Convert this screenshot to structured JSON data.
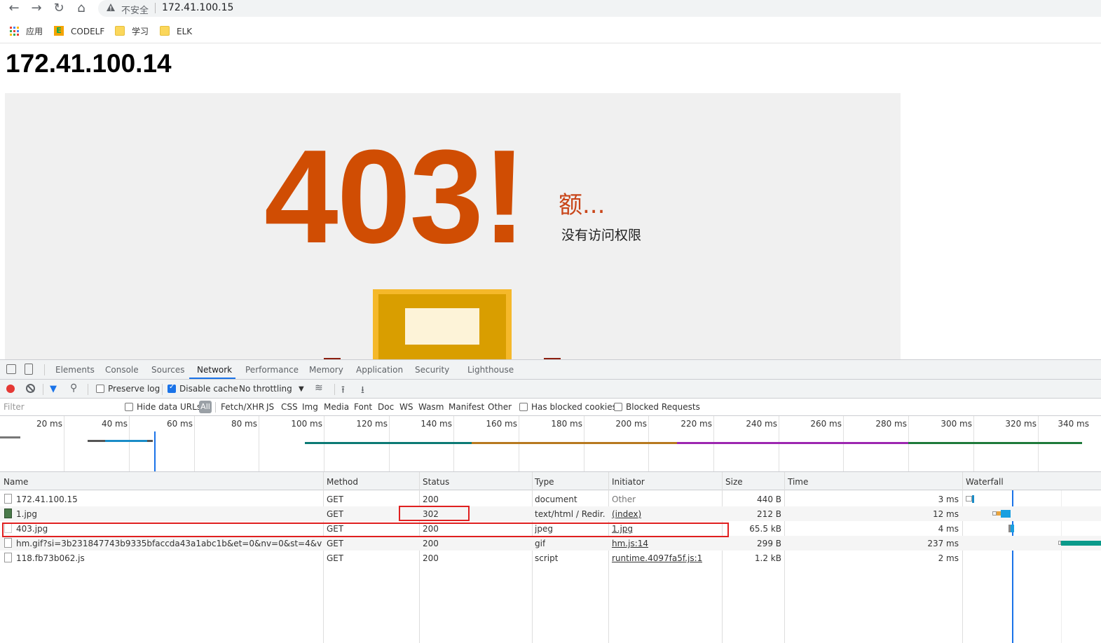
{
  "browser": {
    "url": "172.41.100.15",
    "security_label": "不安全",
    "bookmarks": [
      {
        "label": "应用",
        "icon": "apps-grid-icon"
      },
      {
        "label": "CODELF",
        "icon": "codelf-icon"
      },
      {
        "label": "学习",
        "icon": "folder-icon"
      },
      {
        "label": "ELK",
        "icon": "folder-icon"
      }
    ]
  },
  "page": {
    "heading": "172.41.100.14",
    "error_code": "403!",
    "error_sub1": "额...",
    "error_sub2": "没有访问权限"
  },
  "devtools": {
    "tabs": [
      "Elements",
      "Console",
      "Sources",
      "Network",
      "Performance",
      "Memory",
      "Application",
      "Security",
      "Lighthouse"
    ],
    "active_tab": "Network",
    "toolbar": {
      "preserve_log": "Preserve log",
      "disable_cache": "Disable cache",
      "throttling": "No throttling"
    },
    "filter": {
      "placeholder": "Filter",
      "hide_data_urls": "Hide data URLs",
      "types": [
        "All",
        "Fetch/XHR",
        "JS",
        "CSS",
        "Img",
        "Media",
        "Font",
        "Doc",
        "WS",
        "Wasm",
        "Manifest",
        "Other"
      ],
      "has_blocked_cookies": "Has blocked cookies",
      "blocked_requests": "Blocked Requests"
    },
    "overview_ticks": [
      "20 ms",
      "40 ms",
      "60 ms",
      "80 ms",
      "100 ms",
      "120 ms",
      "140 ms",
      "160 ms",
      "180 ms",
      "200 ms",
      "220 ms",
      "240 ms",
      "260 ms",
      "280 ms",
      "300 ms",
      "320 ms",
      "340 ms"
    ],
    "columns": [
      "Name",
      "Method",
      "Status",
      "Type",
      "Initiator",
      "Size",
      "Time",
      "Waterfall"
    ],
    "requests": [
      {
        "name": "172.41.100.15",
        "method": "GET",
        "status": "200",
        "type": "document",
        "initiator": "Other",
        "size": "440 B",
        "time": "3 ms"
      },
      {
        "name": "1.jpg",
        "method": "GET",
        "status": "302",
        "type": "text/html / Redir...",
        "initiator": "(index)",
        "size": "212 B",
        "time": "12 ms"
      },
      {
        "name": "403.jpg",
        "method": "GET",
        "status": "200",
        "type": "jpeg",
        "initiator": "1.jpg",
        "size": "65.5 kB",
        "time": "4 ms"
      },
      {
        "name": "hm.gif?si=3b231847743b9335bfaccda43a1abc1b&et=0&nv=0&st=4&v=pixel-1...",
        "method": "GET",
        "status": "200",
        "type": "gif",
        "initiator": "hm.js:14",
        "size": "299 B",
        "time": "237 ms"
      },
      {
        "name": "118.fb73b062.js",
        "method": "GET",
        "status": "200",
        "type": "script",
        "initiator": "runtime.4097fa5f.js:1",
        "size": "1.2 kB",
        "time": "2 ms"
      }
    ],
    "colors": {
      "accent": "#1a73e8",
      "highlight": "#e02020",
      "error_orange": "#d04d03"
    }
  }
}
